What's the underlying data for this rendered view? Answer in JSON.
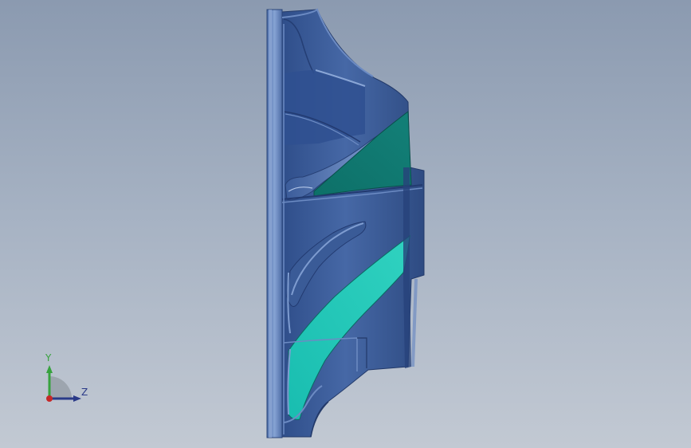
{
  "viewport": {
    "background_top": "#8b9ab0",
    "background_bottom": "#c2c9d3"
  },
  "model": {
    "icon": "impeller-section-model",
    "body_color": "#3e5f9c",
    "hub_color": "#5f7fb8",
    "section_dark_color": "#0f7a72",
    "section_light_color": "#1fc4b4"
  },
  "triad": {
    "icon": "coordinate-axes-icon",
    "y_label": "Y",
    "z_label": "Z",
    "y_color": "#37a23e",
    "z_color": "#2a3a88",
    "origin_color": "#c62828"
  }
}
